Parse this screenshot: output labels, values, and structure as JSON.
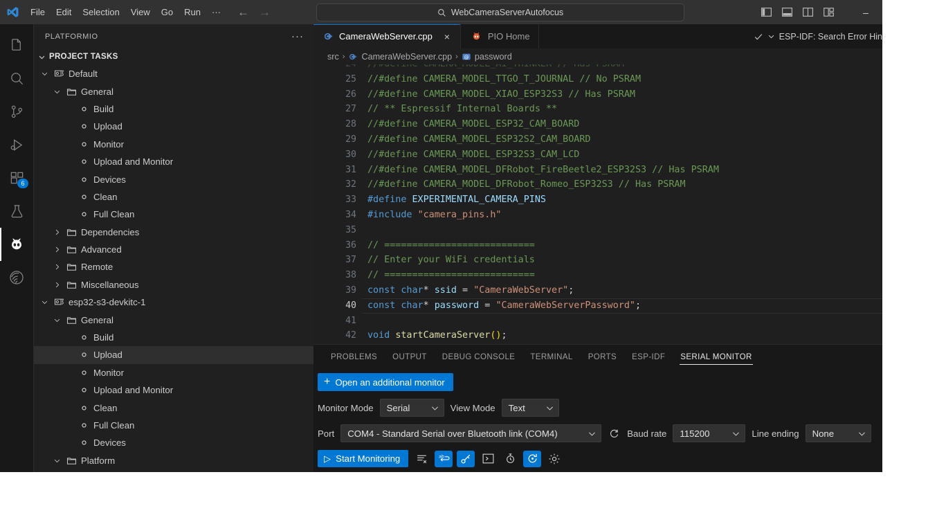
{
  "window": {
    "app": "Visual Studio Code",
    "minimize_label": "–"
  },
  "titlebar": {
    "logo_name": "vscode-logo",
    "menu": [
      "File",
      "Edit",
      "Selection",
      "View",
      "Go",
      "Run",
      "···"
    ],
    "nav_back": "←",
    "nav_forward": "→",
    "search": {
      "icon": "search-icon",
      "value": "WebCameraServerAutofocus"
    },
    "layout_icons": [
      "toggle-primary-sidebar-icon",
      "toggle-panel-icon",
      "toggle-secondary-sidebar-icon",
      "customize-layout-icon"
    ]
  },
  "activity_bar": {
    "items": [
      {
        "name": "explorer",
        "icon": "files-icon",
        "active": false,
        "badge": null
      },
      {
        "name": "search",
        "icon": "search-icon",
        "active": false,
        "badge": null
      },
      {
        "name": "source-control",
        "icon": "source-control-icon",
        "active": false,
        "badge": null
      },
      {
        "name": "run-and-debug",
        "icon": "run-debug-icon",
        "active": false,
        "badge": null
      },
      {
        "name": "extensions",
        "icon": "extensions-icon",
        "active": false,
        "badge": "6"
      },
      {
        "name": "testing",
        "icon": "beaker-icon",
        "active": false,
        "badge": null
      },
      {
        "name": "platformio",
        "icon": "platformio-alien-icon",
        "active": true,
        "badge": null
      },
      {
        "name": "espressif-idf",
        "icon": "espressif-icon",
        "active": false,
        "badge": null
      }
    ]
  },
  "sidebar": {
    "title": "PLATFORMIO",
    "more_actions": "···",
    "section": {
      "label": "PROJECT TASKS",
      "expanded": true
    },
    "tree": [
      {
        "label": "Default",
        "indent": 1,
        "icon": "env-icon",
        "chevron": "down",
        "selected": false
      },
      {
        "label": "General",
        "indent": 2,
        "icon": "folder-icon",
        "chevron": "down",
        "selected": false
      },
      {
        "label": "Build",
        "indent": 3,
        "icon": "task-icon",
        "chevron": "none",
        "selected": false
      },
      {
        "label": "Upload",
        "indent": 3,
        "icon": "task-icon",
        "chevron": "none",
        "selected": false
      },
      {
        "label": "Monitor",
        "indent": 3,
        "icon": "task-icon",
        "chevron": "none",
        "selected": false
      },
      {
        "label": "Upload and Monitor",
        "indent": 3,
        "icon": "task-icon",
        "chevron": "none",
        "selected": false
      },
      {
        "label": "Devices",
        "indent": 3,
        "icon": "task-icon",
        "chevron": "none",
        "selected": false
      },
      {
        "label": "Clean",
        "indent": 3,
        "icon": "task-icon",
        "chevron": "none",
        "selected": false
      },
      {
        "label": "Full Clean",
        "indent": 3,
        "icon": "task-icon",
        "chevron": "none",
        "selected": false
      },
      {
        "label": "Dependencies",
        "indent": 2,
        "icon": "folder-icon",
        "chevron": "right",
        "selected": false
      },
      {
        "label": "Advanced",
        "indent": 2,
        "icon": "folder-icon",
        "chevron": "right",
        "selected": false
      },
      {
        "label": "Remote",
        "indent": 2,
        "icon": "folder-icon",
        "chevron": "right",
        "selected": false
      },
      {
        "label": "Miscellaneous",
        "indent": 2,
        "icon": "folder-icon",
        "chevron": "right",
        "selected": false
      },
      {
        "label": "esp32-s3-devkitc-1",
        "indent": 1,
        "icon": "env-icon",
        "chevron": "down",
        "selected": false
      },
      {
        "label": "General",
        "indent": 2,
        "icon": "folder-icon",
        "chevron": "down",
        "selected": false
      },
      {
        "label": "Build",
        "indent": 3,
        "icon": "task-icon",
        "chevron": "none",
        "selected": false
      },
      {
        "label": "Upload",
        "indent": 3,
        "icon": "task-icon",
        "chevron": "none",
        "selected": true
      },
      {
        "label": "Monitor",
        "indent": 3,
        "icon": "task-icon",
        "chevron": "none",
        "selected": false
      },
      {
        "label": "Upload and Monitor",
        "indent": 3,
        "icon": "task-icon",
        "chevron": "none",
        "selected": false
      },
      {
        "label": "Clean",
        "indent": 3,
        "icon": "task-icon",
        "chevron": "none",
        "selected": false
      },
      {
        "label": "Full Clean",
        "indent": 3,
        "icon": "task-icon",
        "chevron": "none",
        "selected": false
      },
      {
        "label": "Devices",
        "indent": 3,
        "icon": "task-icon",
        "chevron": "none",
        "selected": false
      },
      {
        "label": "Platform",
        "indent": 2,
        "icon": "folder-icon",
        "chevron": "down",
        "selected": false
      }
    ]
  },
  "editor": {
    "tabs": [
      {
        "label": "CameraWebServer.cpp",
        "icon": "cpp-file-icon",
        "active": true,
        "closable": true
      },
      {
        "label": "PIO Home",
        "icon": "platformio-alien-icon",
        "active": false,
        "closable": false
      }
    ],
    "tab_close_label": "×",
    "status_action": {
      "check_icon": "check-icon",
      "chevron_icon": "chevron-down-icon",
      "label": "ESP-IDF: Search Error Hin"
    },
    "breadcrumb": [
      {
        "label": "src",
        "icon": null
      },
      {
        "label": "CameraWebServer.cpp",
        "icon": "cpp-file-icon"
      },
      {
        "label": "password",
        "icon": "variable-icon"
      }
    ],
    "breadcrumb_separator": "›",
    "current_line": 40,
    "lines": [
      {
        "n": 24,
        "partial": true,
        "tokens": [
          {
            "t": "//#define CAMERA_MODEL_AI_THINKER // Has PSRAM",
            "c": "c-com"
          }
        ]
      },
      {
        "n": 25,
        "tokens": [
          {
            "t": "//#define CAMERA_MODEL_TTGO_T_JOURNAL // No PSRAM",
            "c": "c-com"
          }
        ]
      },
      {
        "n": 26,
        "tokens": [
          {
            "t": "//#define CAMERA_MODEL_XIAO_ESP32S3 // Has PSRAM",
            "c": "c-com"
          }
        ]
      },
      {
        "n": 27,
        "tokens": [
          {
            "t": "// ** Espressif Internal Boards **",
            "c": "c-com"
          }
        ]
      },
      {
        "n": 28,
        "tokens": [
          {
            "t": "//#define CAMERA_MODEL_ESP32_CAM_BOARD",
            "c": "c-com"
          }
        ]
      },
      {
        "n": 29,
        "tokens": [
          {
            "t": "//#define CAMERA_MODEL_ESP32S2_CAM_BOARD",
            "c": "c-com"
          }
        ]
      },
      {
        "n": 30,
        "tokens": [
          {
            "t": "//#define CAMERA_MODEL_ESP32S3_CAM_LCD",
            "c": "c-com"
          }
        ]
      },
      {
        "n": 31,
        "tokens": [
          {
            "t": "//#define CAMERA_MODEL_DFRobot_FireBeetle2_ESP32S3 // Has PSRAM",
            "c": "c-com"
          }
        ]
      },
      {
        "n": 32,
        "tokens": [
          {
            "t": "//#define CAMERA_MODEL_DFRobot_Romeo_ESP32S3 // Has PSRAM",
            "c": "c-com"
          }
        ]
      },
      {
        "n": 33,
        "tokens": [
          {
            "t": "#define ",
            "c": "c-kw"
          },
          {
            "t": "EXPERIMENTAL_CAMERA_PINS",
            "c": "c-var"
          }
        ]
      },
      {
        "n": 34,
        "tokens": [
          {
            "t": "#include ",
            "c": "c-kw"
          },
          {
            "t": "\"camera_pins.h\"",
            "c": "c-str"
          }
        ]
      },
      {
        "n": 35,
        "tokens": []
      },
      {
        "n": 36,
        "tokens": [
          {
            "t": "// ===========================",
            "c": "c-com"
          }
        ]
      },
      {
        "n": 37,
        "tokens": [
          {
            "t": "// Enter your WiFi credentials",
            "c": "c-com"
          }
        ]
      },
      {
        "n": 38,
        "tokens": [
          {
            "t": "// ===========================",
            "c": "c-com"
          }
        ]
      },
      {
        "n": 39,
        "tokens": [
          {
            "t": "const ",
            "c": "c-kw"
          },
          {
            "t": "char",
            "c": "c-kw"
          },
          {
            "t": "* ",
            "c": "c-pl"
          },
          {
            "t": "ssid",
            "c": "c-var"
          },
          {
            "t": " = ",
            "c": "c-pl"
          },
          {
            "t": "\"CameraWebServer\"",
            "c": "c-str"
          },
          {
            "t": ";",
            "c": "c-pl"
          }
        ]
      },
      {
        "n": 40,
        "tokens": [
          {
            "t": "const ",
            "c": "c-kw"
          },
          {
            "t": "char",
            "c": "c-kw"
          },
          {
            "t": "* ",
            "c": "c-pl"
          },
          {
            "t": "password",
            "c": "c-var"
          },
          {
            "t": " = ",
            "c": "c-pl"
          },
          {
            "t": "\"CameraWebServerPassword\"",
            "c": "c-str"
          },
          {
            "t": ";",
            "c": "c-pl"
          }
        ]
      },
      {
        "n": 41,
        "tokens": []
      },
      {
        "n": 42,
        "tokens": [
          {
            "t": "void ",
            "c": "c-kw"
          },
          {
            "t": "startCameraServer",
            "c": "c-fn"
          },
          {
            "t": "()",
            "c": "c-yel"
          },
          {
            "t": ";",
            "c": "c-pl"
          }
        ]
      }
    ]
  },
  "panel": {
    "tabs": [
      {
        "label": "PROBLEMS",
        "active": false
      },
      {
        "label": "OUTPUT",
        "active": false
      },
      {
        "label": "DEBUG CONSOLE",
        "active": false
      },
      {
        "label": "TERMINAL",
        "active": false
      },
      {
        "label": "PORTS",
        "active": false
      },
      {
        "label": "ESP-IDF",
        "active": false
      },
      {
        "label": "SERIAL MONITOR",
        "active": true
      }
    ],
    "serial_monitor": {
      "open_additional_label": "Open an additional monitor",
      "plus_glyph": "+",
      "monitor_mode_label": "Monitor Mode",
      "monitor_mode_value": "Serial",
      "view_mode_label": "View Mode",
      "view_mode_value": "Text",
      "port_label": "Port",
      "port_value": "COM4 - Standard Serial over Bluetooth link (COM4)",
      "refresh_icon": "refresh-icon",
      "baud_label": "Baud rate",
      "baud_value": "115200",
      "line_ending_label": "Line ending",
      "line_ending_value": "None",
      "start_button_label": "Start Monitoring",
      "play_glyph": "▷",
      "toolbar_icons": [
        {
          "name": "clear-output-icon",
          "active": false
        },
        {
          "name": "toggle-word-wrap-icon",
          "active": true
        },
        {
          "name": "toggle-timestamp-icon",
          "active": true
        },
        {
          "name": "open-terminal-icon",
          "active": false
        },
        {
          "name": "monitor-history-icon",
          "active": false
        },
        {
          "name": "auto-reconnect-icon",
          "active": true
        },
        {
          "name": "settings-gear-icon",
          "active": false
        }
      ]
    }
  },
  "colors": {
    "accent": "#0078d4",
    "editor_bg": "#1f1f1f",
    "sidebar_bg": "#202020",
    "activity_bg": "#181818",
    "titlebar_bg": "#323233",
    "comment": "#6A9955",
    "keyword": "#569cd6",
    "string": "#ce9178",
    "function": "#dcdcaa",
    "variable": "#9cdcfe"
  }
}
